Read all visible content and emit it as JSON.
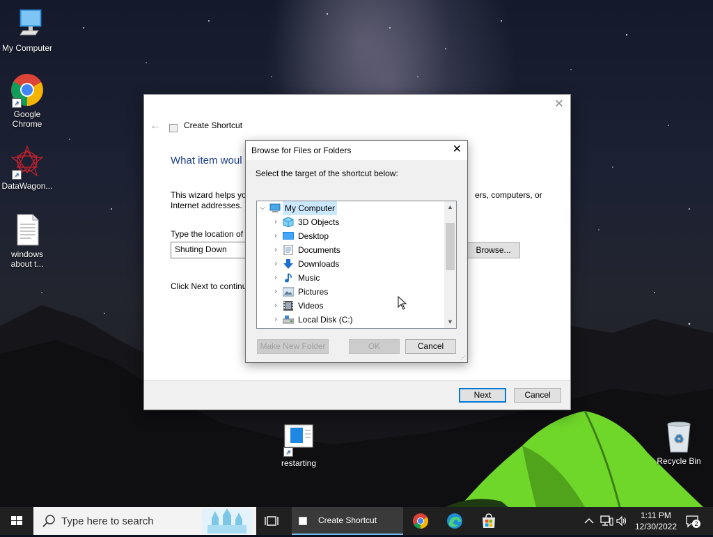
{
  "desktop": {
    "icons": [
      {
        "label": "My Computer"
      },
      {
        "label": "Google Chrome"
      },
      {
        "label": "DataWagon..."
      },
      {
        "label": "windows about t..."
      },
      {
        "label": "restarting"
      },
      {
        "label": "Recycle Bin"
      }
    ]
  },
  "wizard": {
    "title": "Create Shortcut",
    "heading": "What item woul",
    "desc_line1_left": "This wizard helps you",
    "desc_line1_right": "ers, computers, or",
    "desc_line2": "Internet addresses.",
    "type_location_label": "Type the location of t",
    "location_value": "Shuting Down",
    "browse_label": "Browse...",
    "click_next_text": "Click Next to continu",
    "next_label": "Next",
    "cancel_label": "Cancel"
  },
  "browse_dialog": {
    "title": "Browse for Files or Folders",
    "instruction": "Select the target of the shortcut below:",
    "tree": [
      {
        "label": "My Computer",
        "icon": "computer-icon",
        "expanded": true,
        "selected": true
      },
      {
        "label": "3D Objects",
        "icon": "3d-objects-icon"
      },
      {
        "label": "Desktop",
        "icon": "desktop-folder-icon"
      },
      {
        "label": "Documents",
        "icon": "documents-icon"
      },
      {
        "label": "Downloads",
        "icon": "downloads-icon"
      },
      {
        "label": "Music",
        "icon": "music-icon"
      },
      {
        "label": "Pictures",
        "icon": "pictures-icon"
      },
      {
        "label": "Videos",
        "icon": "videos-icon"
      },
      {
        "label": "Local Disk (C:)",
        "icon": "local-disk-icon"
      }
    ],
    "make_new_folder_label": "Make New Folder",
    "ok_label": "OK",
    "cancel_label": "Cancel"
  },
  "taskbar": {
    "search_placeholder": "Type here to search",
    "active_task_label": "Create Shortcut",
    "time": "1:11 PM",
    "date": "12/30/2022",
    "notification_count": "2"
  },
  "colors": {
    "accent": "#0078d7",
    "heading": "#1b3d8a",
    "selection": "#cce8ff",
    "taskbar": "#202020"
  }
}
